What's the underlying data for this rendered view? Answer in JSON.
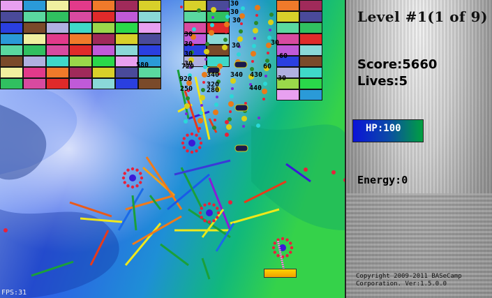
{
  "game": {
    "fps_label": "FPS:31",
    "score_popups": [
      "580",
      "30",
      "30",
      "30",
      "30",
      "30",
      "30",
      "30",
      "720",
      "340",
      "920",
      "320",
      "250",
      "280",
      "30",
      "430",
      "340",
      "440",
      "30",
      "60",
      "60",
      "30"
    ],
    "colors": {
      "bg_left": "#2f5ae8",
      "bg_right": "#1fc78a",
      "paddle": "#ffd400"
    }
  },
  "panel": {
    "level_title": "Level #1(1 of 9)",
    "score": "Score:5660",
    "lives": "Lives:5",
    "hp": "HP:100",
    "energy": "Energy:0",
    "copyright_line1": "Copyright 2009-2011 BASeCamp",
    "copyright_line2": "Corporation. Ver:1.5.0.0"
  }
}
